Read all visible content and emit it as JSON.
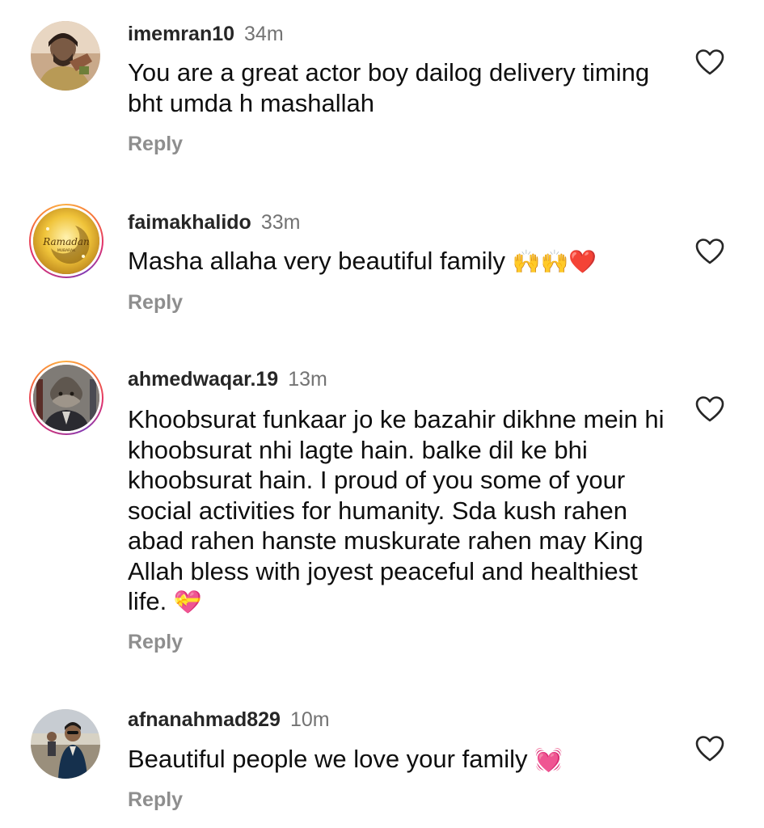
{
  "comments": [
    {
      "username": "imemran10",
      "time": "34m",
      "text": "You are a great actor boy dailog delivery timing bht umda h mashallah",
      "emoji": "",
      "reply_label": "Reply",
      "has_story": false
    },
    {
      "username": "faimakhalido",
      "time": "33m",
      "text": "Masha allaha very beautiful family",
      "emoji": "🙌🙌❤️",
      "reply_label": "Reply",
      "has_story": true,
      "avatar_text": "Ramadan",
      "avatar_subtext": "MUBARAK"
    },
    {
      "username": "ahmedwaqar.19",
      "time": "13m",
      "text": "Khoobsurat funkaar jo ke bazahir dikhne mein hi khoobsurat nhi lagte hain. balke dil ke bhi khoobsurat hain. I proud of you some of your social activities for humanity. Sda kush rahen abad rahen hanste muskurate rahen may King Allah bless with joyest peaceful and healthiest life.",
      "emoji": "💝",
      "reply_label": "Reply",
      "has_story": true
    },
    {
      "username": "afnanahmad829",
      "time": "10m",
      "text": "Beautiful people we love your family",
      "emoji": "💓",
      "reply_label": "Reply",
      "has_story": false
    }
  ],
  "colors": {
    "username": "#262626",
    "timestamp": "#737373",
    "reply": "#8e8e8e",
    "story_ring": [
      "#c13584",
      "#e1306c",
      "#f77737",
      "#fcaf45",
      "#833ab4"
    ]
  },
  "icons": {
    "like": "heart-outline-icon"
  }
}
